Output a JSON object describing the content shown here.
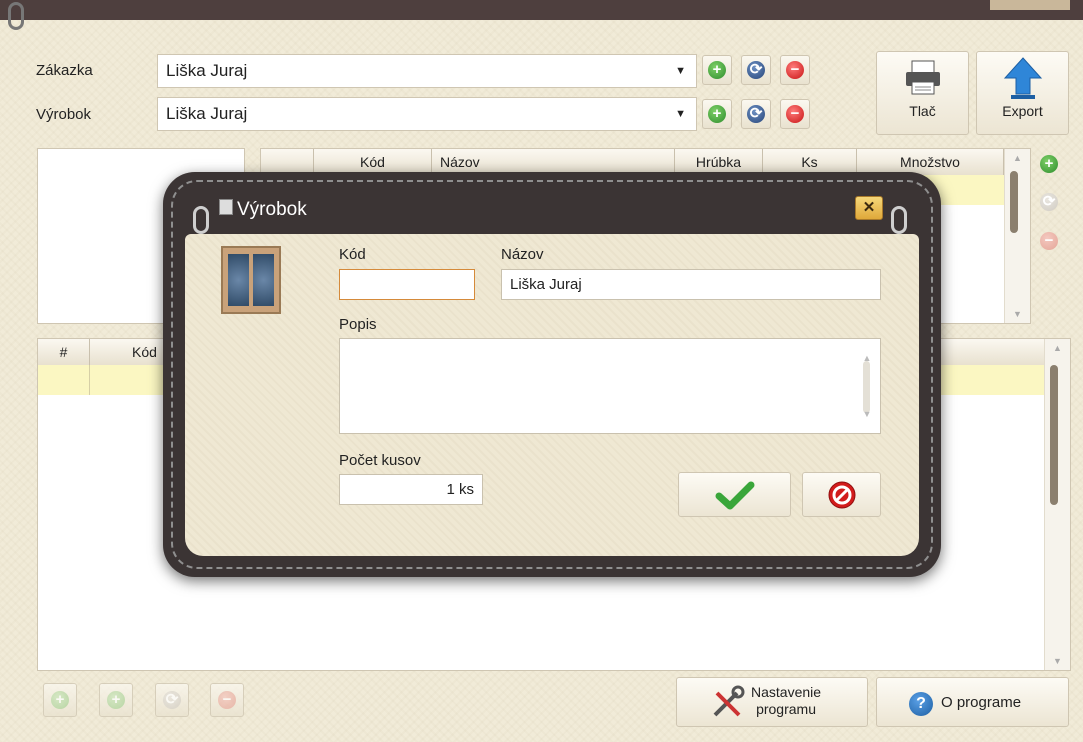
{
  "form": {
    "zakazka_label": "Zákazka",
    "zakazka_value": "Liška Juraj",
    "vyrobok_label": "Výrobok",
    "vyrobok_value": "Liška Juraj"
  },
  "toolbar": {
    "print_label": "Tlač",
    "export_label": "Export"
  },
  "upper_table": {
    "columns": [
      "Kód",
      "Názov",
      "Hrúbka",
      "Ks",
      "Množstvo"
    ]
  },
  "lower_table": {
    "columns": [
      "#",
      "Kód"
    ]
  },
  "footer": {
    "settings_label_line1": "Nastavenie",
    "settings_label_line2": "programu",
    "about_label": "O programe"
  },
  "dialog": {
    "title": "Výrobok",
    "kod_label": "Kód",
    "kod_value": "",
    "nazov_label": "Názov",
    "nazov_value": "Liška Juraj",
    "popis_label": "Popis",
    "popis_value": "",
    "pocet_label": "Počet kusov",
    "pocet_value": "1 ks"
  },
  "colors": {
    "accent_green": "#2d8d2d",
    "accent_red": "#c81414",
    "selected_row": "#fbf7c2",
    "dialog_frame": "#3b3434"
  }
}
